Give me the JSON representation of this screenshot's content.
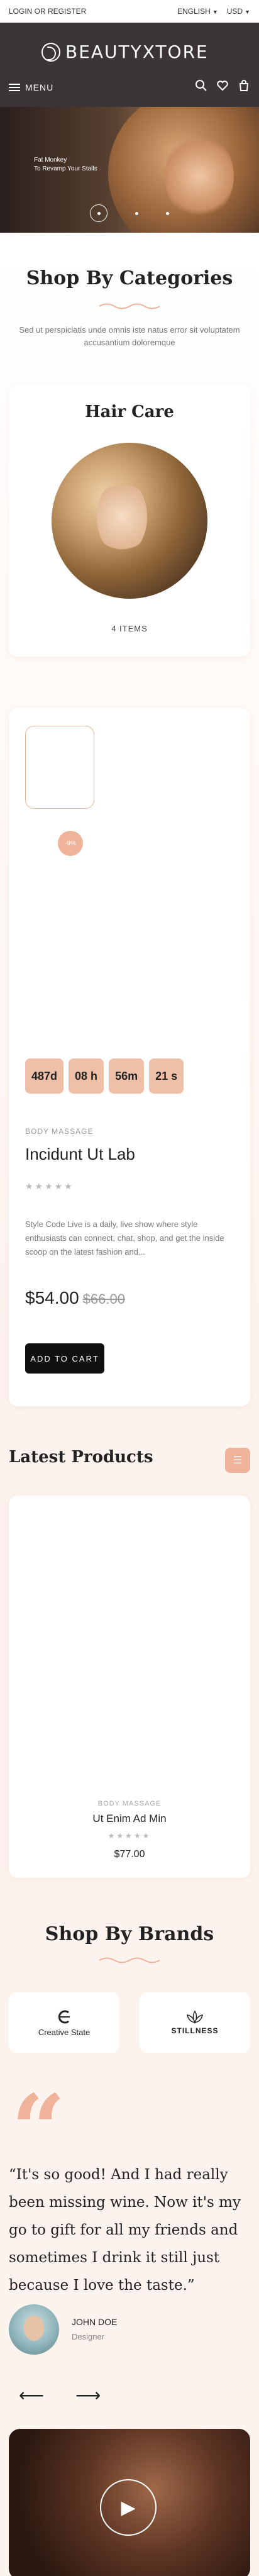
{
  "topbar": {
    "login": "LOGIN OR REGISTER",
    "language": "ENGLISH",
    "currency": "USD"
  },
  "header": {
    "logo": "BEAUTYXTORE",
    "menu": "MENU"
  },
  "hero": {
    "line1": "Fat Monkey",
    "line2": "To Revamp Your Stalls",
    "slide_count": 3,
    "active_slide": 1
  },
  "categories": {
    "title": "Shop By Categories",
    "subtitle": "Sed ut perspiciatis unde omnis iste natus error sit voluptatem accusantium doloremque",
    "card_title": "Hair Care",
    "items": "4 ITEMS"
  },
  "deal": {
    "badge": "-9%",
    "timer": [
      "487d",
      "08 h",
      "56m",
      "21 s"
    ],
    "category": "BODY MASSAGE",
    "name": "Incidunt Ut Lab",
    "rating": "★★★★★",
    "rating_value": 0,
    "description": "Style Code Live is a daily, live show where style enthusiasts can connect, chat, shop, and get the inside scoop on the latest fashion and...",
    "price": "$54.00",
    "old_price": "$66.00",
    "cart": "ADD TO CART"
  },
  "latest": {
    "title": "Latest Products",
    "category": "BODY MASSAGE",
    "name": "Ut Enim Ad Min",
    "rating": "★★★★★",
    "rating_value": 0,
    "price": "$77.00"
  },
  "brands": {
    "title": "Shop By Brands",
    "items": [
      "Creative State",
      "STILLNESS"
    ]
  },
  "testimonial": {
    "quote": "“It's so good! And I had really been missing wine. Now it's my go to gift for all my friends and sometimes I drink it still just because I love the taste.”",
    "author": "JOHN DOE",
    "role": "Designer"
  },
  "colors": {
    "accent": "#efb39a",
    "dark": "#3b3538",
    "page_bg": "#fdf3ee"
  }
}
